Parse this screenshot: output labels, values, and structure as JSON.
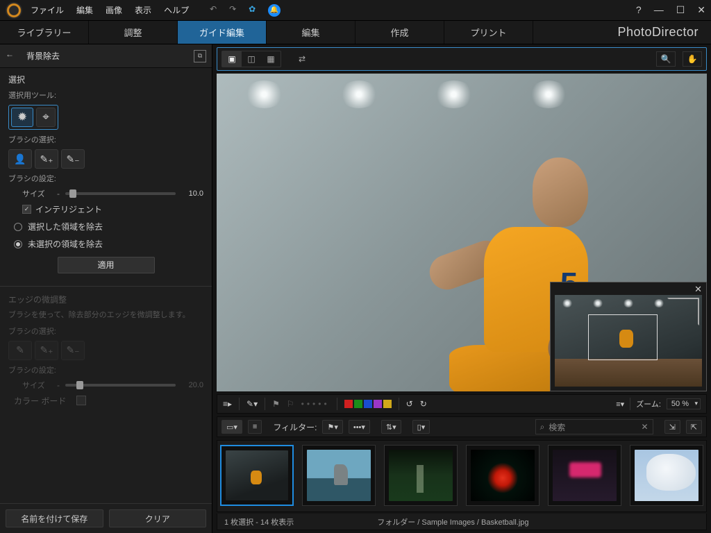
{
  "menu": {
    "file": "ファイル",
    "edit": "編集",
    "image": "画像",
    "view": "表示",
    "help": "ヘルプ"
  },
  "brand": "PhotoDirector",
  "tabs": {
    "library": "ライブラリー",
    "adjustment": "調整",
    "guided": "ガイド編集",
    "edit": "編集",
    "create": "作成",
    "print": "プリント"
  },
  "panel": {
    "title": "背景除去",
    "selection": "選択",
    "selection_tool": "選択用ツール:",
    "brush_select": "ブラシの選択:",
    "brush_settings": "ブラシの設定:",
    "size_label": "サイズ",
    "size_value": "10.0",
    "intelligent": "インテリジェント",
    "remove_selected": "選択した領域を除去",
    "remove_unselected": "未選択の領域を除去",
    "apply": "適用",
    "edge": {
      "title": "エッジの微調整",
      "desc": "ブラシを使って、除去部分のエッジを微調整します。",
      "brush_select": "ブラシの選択:",
      "brush_settings": "ブラシの設定:",
      "size_label": "サイズ",
      "size_value": "20.0",
      "color_board": "カラー ボード"
    },
    "save_as": "名前を付けて保存",
    "clear": "クリア"
  },
  "jersey_number": "5",
  "midbar": {
    "zoom_label": "ズーム:",
    "zoom_value": "50 %",
    "colors": [
      "#d02020",
      "#1a8c1a",
      "#1a4cd0",
      "#9a36c8",
      "#d0a81a"
    ]
  },
  "filterbar": {
    "filter_label": "フィルター:",
    "search_placeholder": "検索"
  },
  "status": {
    "selection": "1 枚選択 - 14 枚表示",
    "path": "フォルダー  / Sample Images  / Basketball.jpg"
  }
}
